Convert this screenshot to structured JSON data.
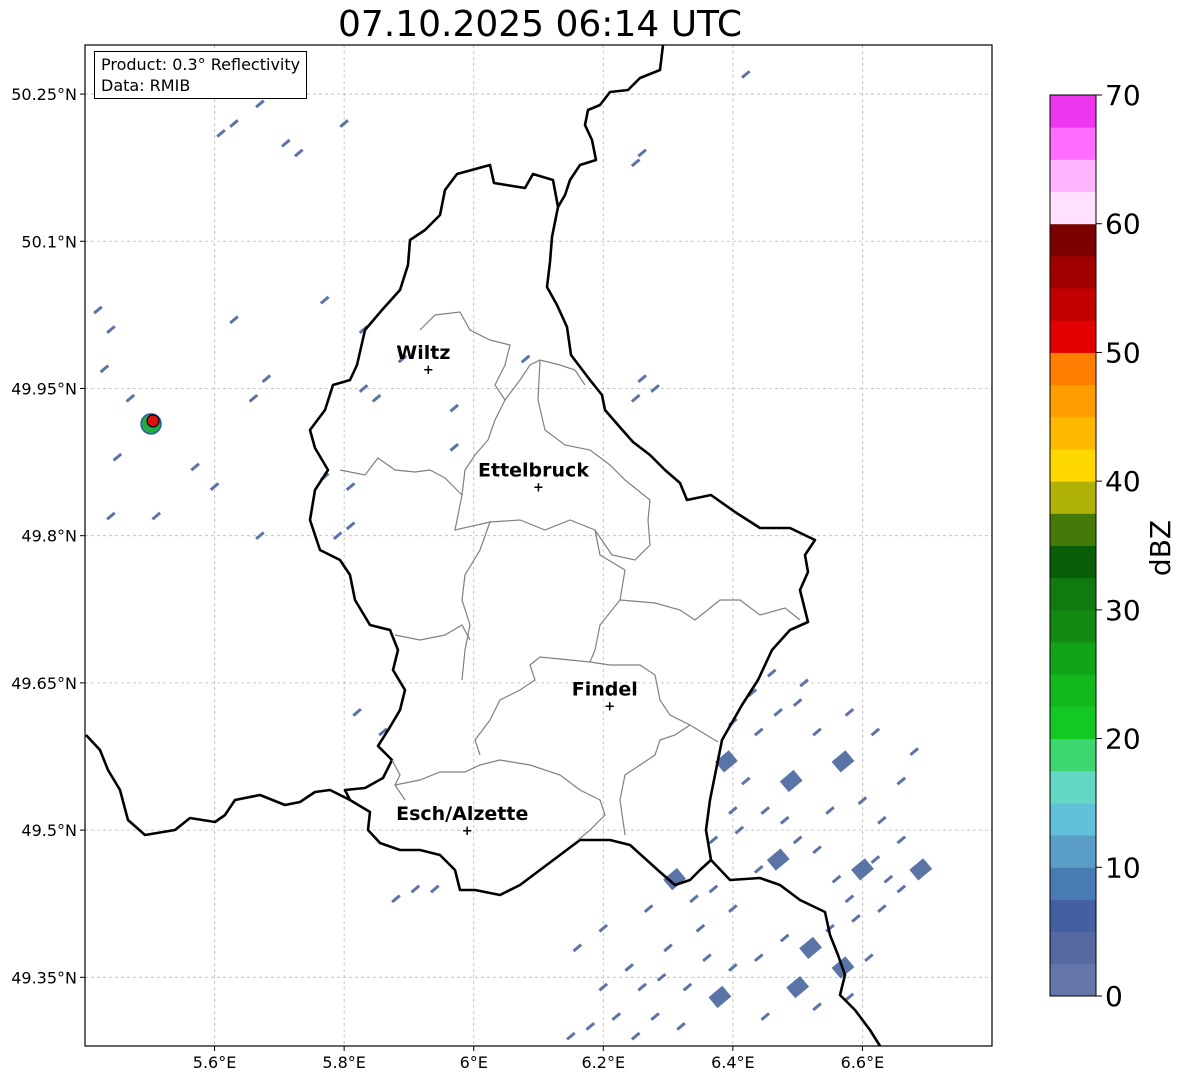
{
  "title": "07.10.2025 06:14 UTC",
  "info": {
    "product": "Product: 0.3° Reflectivity",
    "source": "Data: RMIB"
  },
  "map": {
    "lon_range": [
      5.4,
      6.8
    ],
    "lat_range": [
      49.28,
      50.3
    ],
    "lon_ticks": [
      {
        "value": 5.6,
        "label": "5.6°E"
      },
      {
        "value": 5.8,
        "label": "5.8°E"
      },
      {
        "value": 6.0,
        "label": "6°E"
      },
      {
        "value": 6.2,
        "label": "6.2°E"
      },
      {
        "value": 6.4,
        "label": "6.4°E"
      },
      {
        "value": 6.6,
        "label": "6.6°E"
      }
    ],
    "lat_ticks": [
      {
        "value": 50.25,
        "label": "50.25°N"
      },
      {
        "value": 50.1,
        "label": "50.1°N"
      },
      {
        "value": 49.95,
        "label": "49.95°N"
      },
      {
        "value": 49.8,
        "label": "49.8°N"
      },
      {
        "value": 49.65,
        "label": "49.65°N"
      },
      {
        "value": 49.5,
        "label": "49.5°N"
      },
      {
        "value": 49.35,
        "label": "49.35°N"
      }
    ],
    "grid": true,
    "cities": [
      {
        "name": "Wiltz",
        "lon": 5.93,
        "lat": 49.97
      },
      {
        "name": "Ettelbruck",
        "lon": 6.1,
        "lat": 49.85
      },
      {
        "name": "Findel",
        "lon": 6.21,
        "lat": 49.627
      },
      {
        "name": "Esch/Alzette",
        "lon": 5.99,
        "lat": 49.5
      }
    ],
    "radar_site": {
      "lon": 5.505,
      "lat": 49.917,
      "color": "#e01010"
    },
    "border_color": "#000000",
    "canton_color": "#808080",
    "echo_color": "#5a74a8",
    "echo_cells": [
      [
        6.31,
        49.45
      ],
      [
        6.34,
        49.43
      ],
      [
        6.37,
        49.44
      ],
      [
        6.4,
        49.42
      ],
      [
        6.44,
        49.46
      ],
      [
        6.47,
        49.47
      ],
      [
        6.5,
        49.49
      ],
      [
        6.53,
        49.48
      ],
      [
        6.56,
        49.45
      ],
      [
        6.58,
        49.43
      ],
      [
        6.6,
        49.46
      ],
      [
        6.62,
        49.47
      ],
      [
        6.64,
        49.45
      ],
      [
        6.59,
        49.41
      ],
      [
        6.55,
        49.4
      ],
      [
        6.52,
        49.38
      ],
      [
        6.48,
        49.39
      ],
      [
        6.44,
        49.37
      ],
      [
        6.4,
        49.36
      ],
      [
        6.36,
        49.37
      ],
      [
        6.38,
        49.33
      ],
      [
        6.33,
        49.34
      ],
      [
        6.29,
        49.35
      ],
      [
        6.26,
        49.34
      ],
      [
        6.22,
        49.31
      ],
      [
        6.18,
        49.3
      ],
      [
        6.15,
        49.29
      ],
      [
        6.28,
        49.31
      ],
      [
        6.32,
        49.3
      ],
      [
        6.42,
        49.55
      ],
      [
        6.39,
        49.57
      ],
      [
        6.44,
        49.6
      ],
      [
        6.47,
        49.62
      ],
      [
        6.5,
        49.63
      ],
      [
        6.53,
        49.6
      ],
      [
        6.57,
        49.57
      ],
      [
        6.6,
        49.53
      ],
      [
        6.63,
        49.51
      ],
      [
        6.66,
        49.49
      ],
      [
        6.55,
        49.52
      ],
      [
        6.49,
        49.55
      ],
      [
        6.45,
        49.52
      ],
      [
        6.41,
        49.5
      ],
      [
        6.37,
        49.49
      ],
      [
        6.61,
        49.37
      ],
      [
        6.57,
        49.36
      ],
      [
        6.68,
        49.58
      ],
      [
        6.46,
        49.66
      ],
      [
        6.43,
        49.64
      ],
      [
        6.4,
        49.61
      ],
      [
        6.51,
        49.65
      ],
      [
        6.58,
        49.62
      ],
      [
        6.62,
        49.6
      ],
      [
        6.66,
        49.55
      ],
      [
        6.35,
        49.4
      ],
      [
        6.3,
        49.38
      ],
      [
        6.24,
        49.36
      ],
      [
        6.2,
        49.34
      ],
      [
        6.25,
        49.29
      ],
      [
        6.45,
        49.31
      ],
      [
        6.5,
        49.34
      ],
      [
        6.53,
        49.32
      ],
      [
        6.58,
        49.33
      ],
      [
        6.63,
        49.42
      ],
      [
        6.66,
        49.44
      ],
      [
        6.69,
        49.46
      ],
      [
        5.91,
        49.44
      ],
      [
        5.94,
        49.44
      ],
      [
        5.88,
        49.43
      ],
      [
        5.83,
        50.01
      ],
      [
        5.83,
        49.95
      ],
      [
        5.85,
        49.94
      ],
      [
        5.97,
        49.93
      ],
      [
        5.97,
        49.89
      ],
      [
        6.08,
        49.98
      ],
      [
        6.26,
        50.19
      ],
      [
        6.25,
        50.18
      ],
      [
        6.42,
        50.27
      ],
      [
        5.61,
        50.21
      ],
      [
        5.63,
        50.22
      ],
      [
        5.67,
        50.24
      ],
      [
        5.71,
        50.2
      ],
      [
        5.73,
        50.19
      ],
      [
        5.8,
        50.22
      ],
      [
        5.77,
        50.04
      ],
      [
        5.63,
        50.02
      ],
      [
        5.68,
        49.96
      ],
      [
        5.66,
        49.94
      ],
      [
        5.6,
        49.85
      ],
      [
        5.67,
        49.8
      ],
      [
        5.79,
        49.8
      ],
      [
        5.81,
        49.81
      ],
      [
        5.77,
        49.86
      ],
      [
        5.81,
        49.85
      ],
      [
        5.89,
        49.98
      ],
      [
        6.28,
        49.95
      ],
      [
        6.26,
        49.96
      ],
      [
        6.25,
        49.94
      ],
      [
        5.47,
        49.94
      ],
      [
        5.45,
        49.88
      ],
      [
        5.44,
        49.82
      ],
      [
        5.43,
        49.97
      ],
      [
        5.42,
        50.03
      ],
      [
        5.44,
        50.01
      ],
      [
        5.51,
        49.82
      ],
      [
        5.57,
        49.87
      ],
      [
        5.82,
        49.62
      ],
      [
        5.86,
        49.6
      ],
      [
        6.2,
        49.4
      ],
      [
        6.27,
        49.42
      ],
      [
        6.16,
        49.38
      ],
      [
        6.4,
        49.52
      ],
      [
        6.48,
        49.51
      ]
    ]
  },
  "colorbar": {
    "label": "dBZ",
    "ticks": [
      "0",
      "10",
      "20",
      "30",
      "40",
      "50",
      "60",
      "70"
    ],
    "levels": [
      "#6477a8",
      "#5568a0",
      "#4560a2",
      "#4a7cb4",
      "#5a9ec8",
      "#62c0da",
      "#62d8c4",
      "#3ed66e",
      "#12c822",
      "#12b81c",
      "#12a418",
      "#128a12",
      "#107a10",
      "#0a5e0a",
      "#467a08",
      "#b0b208",
      "#ffd800",
      "#ffb800",
      "#ff9c00",
      "#ff7e00",
      "#e20000",
      "#c20000",
      "#a00000",
      "#7c0000",
      "#ffe0ff",
      "#ffb4ff",
      "#ff6cff",
      "#ee36ee"
    ]
  }
}
